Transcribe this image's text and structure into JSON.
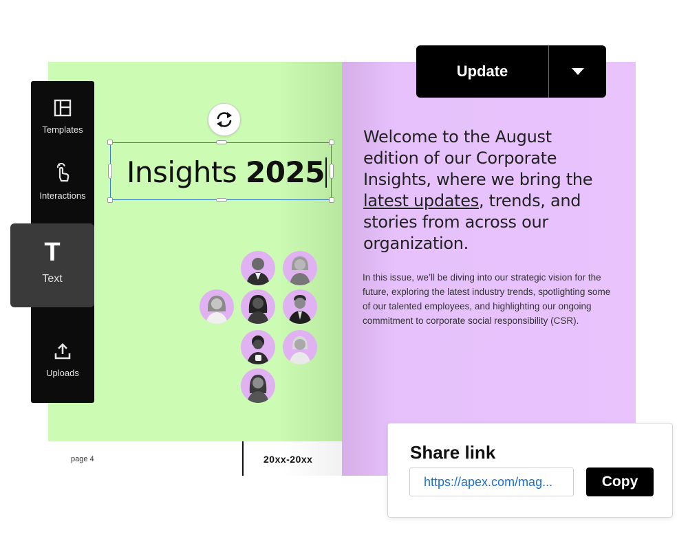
{
  "toolbar": {
    "items": [
      {
        "label": "Templates",
        "icon": "layout-template-icon"
      },
      {
        "label": "Interactions",
        "icon": "tap-hand-icon"
      },
      {
        "label": "Text",
        "icon": "text-t-icon",
        "active": true
      },
      {
        "label": "Uploads",
        "icon": "upload-icon"
      }
    ],
    "text_glyph": "T"
  },
  "header": {
    "update_label": "Update"
  },
  "magazine": {
    "title_regular": "Insights ",
    "title_bold": "2025",
    "page_number": "page 4",
    "page_range": "20xx-20xx",
    "intro_before": "Welcome to the August edition of our Corporate Insights, where we bring the ",
    "intro_link": "latest updates",
    "intro_after": ", trends, and stories from across our organization.",
    "body": "In this issue, we’ll be diving into our strategic vision for the future, exploring the latest industry trends, spotlighting some of our talented employees, and highlighting our ongoing commitment to corporate social responsibility (CSR).",
    "colors": {
      "left_page": "#ccfcb4",
      "right_page": "#e8c3fc",
      "avatar_bg": "#e0b2f2",
      "selection": "#3a7bd5"
    }
  },
  "share": {
    "title": "Share link",
    "url": "https://apex.com/mag...",
    "copy_label": "Copy",
    "url_color": "#1a6fd6"
  }
}
